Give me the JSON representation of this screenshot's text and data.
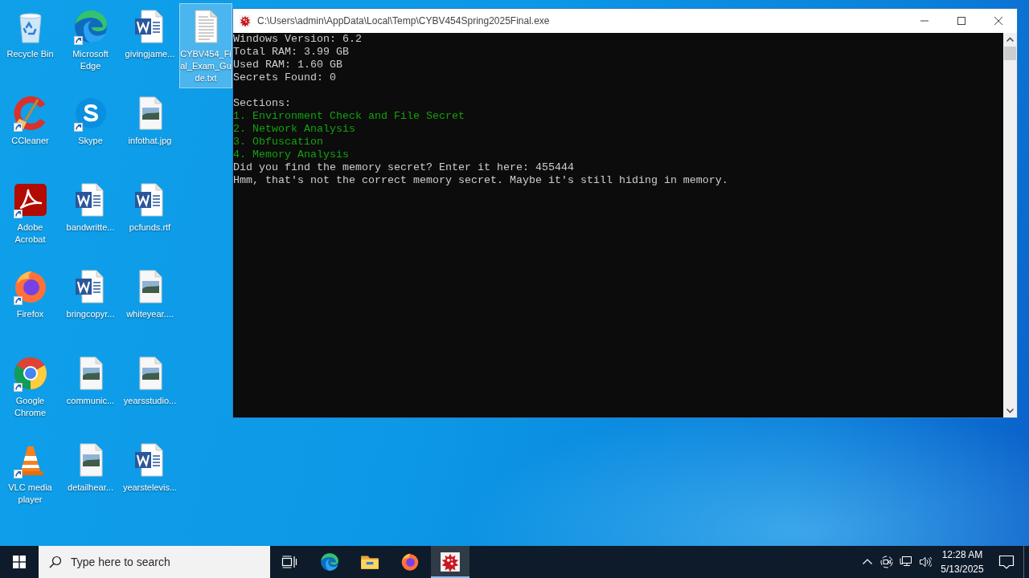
{
  "desktop_icons": [
    {
      "label": "Recycle Bin",
      "kind": "recycle-bin",
      "shortcut": false,
      "selected": false
    },
    {
      "label": "CCleaner",
      "kind": "ccleaner",
      "shortcut": true,
      "selected": false
    },
    {
      "label": "Adobe Acrobat",
      "kind": "acrobat",
      "shortcut": true,
      "selected": false
    },
    {
      "label": "Firefox",
      "kind": "firefox",
      "shortcut": true,
      "selected": false
    },
    {
      "label": "Google Chrome",
      "kind": "chrome",
      "shortcut": true,
      "selected": false
    },
    {
      "label": "VLC media player",
      "kind": "vlc",
      "shortcut": true,
      "selected": false
    },
    {
      "label": "Microsoft Edge",
      "kind": "edge",
      "shortcut": true,
      "selected": false
    },
    {
      "label": "Skype",
      "kind": "skype",
      "shortcut": true,
      "selected": false
    },
    {
      "label": "bandwritte...",
      "kind": "word-doc",
      "shortcut": false,
      "selected": false
    },
    {
      "label": "bringcopyr...",
      "kind": "word-doc",
      "shortcut": false,
      "selected": false
    },
    {
      "label": "communic...",
      "kind": "image-file",
      "shortcut": false,
      "selected": false
    },
    {
      "label": "detailhear...",
      "kind": "image-file",
      "shortcut": false,
      "selected": false
    },
    {
      "label": "givingjame...",
      "kind": "word-doc",
      "shortcut": false,
      "selected": false
    },
    {
      "label": "infothat.jpg",
      "kind": "image-file",
      "shortcut": false,
      "selected": false
    },
    {
      "label": "pcfunds.rtf",
      "kind": "word-doc",
      "shortcut": false,
      "selected": false
    },
    {
      "label": "whiteyear....",
      "kind": "image-file",
      "shortcut": false,
      "selected": false
    },
    {
      "label": "yearsstudio...",
      "kind": "image-file",
      "shortcut": false,
      "selected": false
    },
    {
      "label": "yearstelevis...",
      "kind": "word-doc",
      "shortcut": false,
      "selected": false
    },
    {
      "label": "CYBV454_Fi al_Exam_Gu de.txt",
      "kind": "text-doc",
      "shortcut": false,
      "selected": true
    }
  ],
  "window": {
    "title": "C:\\Users\\admin\\AppData\\Local\\Temp\\CYBV454Spring2025Final.exe",
    "console": {
      "status_lines": [
        "Windows Version: 6.2",
        "Total RAM: 3.99 GB",
        "Used RAM: 1.60 GB",
        "Secrets Found: 0"
      ],
      "sections_heading": "Sections:",
      "sections": [
        "1. Environment Check and File Secret",
        "2. Network Analysis",
        "3. Obfuscation",
        "4. Memory Analysis"
      ],
      "prompt": "Did you find the memory secret? Enter it here:",
      "entered_value": "455444",
      "response": "Hmm, that's not the correct memory secret. Maybe it's still hiding in memory."
    }
  },
  "taskbar": {
    "search": {
      "placeholder": "Type here to search"
    },
    "apps": [
      {
        "kind": "edge",
        "active": false
      },
      {
        "kind": "explorer",
        "active": false
      },
      {
        "kind": "firefox",
        "active": false
      },
      {
        "kind": "console-app",
        "active": true
      }
    ],
    "clock": {
      "time": "12:28 AM",
      "date": "5/13/2025"
    }
  }
}
